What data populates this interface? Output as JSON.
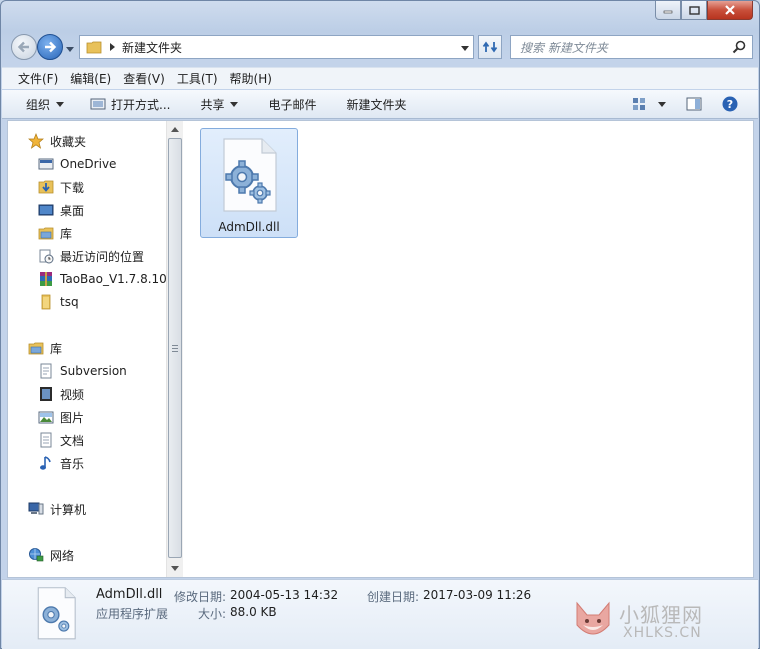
{
  "window": {
    "folder_name": "新建文件夹"
  },
  "address_bar": {
    "crumb": "新建文件夹",
    "search_placeholder": "搜索 新建文件夹"
  },
  "menu": [
    "文件(F)",
    "编辑(E)",
    "查看(V)",
    "工具(T)",
    "帮助(H)"
  ],
  "toolbar": {
    "organize": "组织",
    "open_with": "打开方式...",
    "share": "共享",
    "email": "电子邮件",
    "new_folder": "新建文件夹"
  },
  "nav_pane": {
    "favorites_header": "收藏夹",
    "favorites": [
      "OneDrive",
      "下载",
      "桌面",
      "库",
      "最近访问的位置",
      "TaoBao_V1.7.8.10_",
      "tsq"
    ],
    "libraries_header": "库",
    "libraries": [
      "Subversion",
      "视频",
      "图片",
      "文档",
      "音乐"
    ],
    "computer": "计算机",
    "network": "网络"
  },
  "files": [
    {
      "name": "AdmDll.dll",
      "icon": "dll-gear-icon",
      "selected": true
    }
  ],
  "details": {
    "file_name": "AdmDll.dll",
    "file_type": "应用程序扩展",
    "modified_label": "修改日期:",
    "modified_value": "2004-05-13 14:32",
    "created_label": "创建日期:",
    "created_value": "2017-03-09 11:26",
    "size_label": "大小:",
    "size_value": "88.0 KB"
  },
  "watermark": {
    "text_cn": "小狐狸网",
    "text_en": "XHLKS.CN"
  },
  "colors": {
    "frame": "#c3d3ea",
    "selection": "#cde0f7",
    "selection_border": "#84acdd",
    "close_button": "#c9503b"
  }
}
